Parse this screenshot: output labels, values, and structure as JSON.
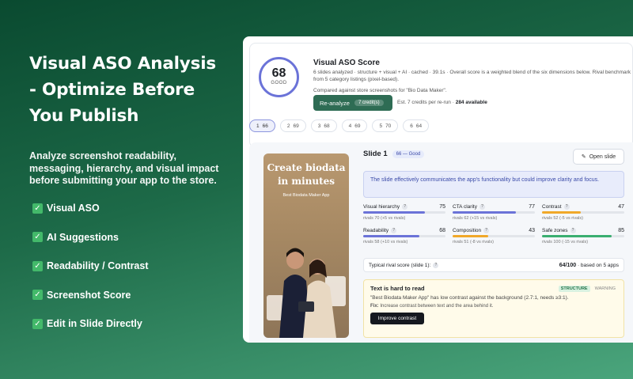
{
  "promo": {
    "headline": "Visual ASO Analysis - Optimize Before You Publish",
    "subheadline": "Analyze screenshot readability, messaging, hierarchy, and visual impact before submitting your app to the store.",
    "features": [
      "Visual ASO",
      "AI Suggestions",
      "Readability / Contrast",
      "Screenshot Score",
      "Edit in Slide Directly"
    ]
  },
  "score": {
    "value": "68",
    "label": "GOOD",
    "title": "Visual ASO Score",
    "description": "6 slides analyzed · structure + visual + AI · cached · 39.1s · Overall score is a weighted blend of the six dimensions below. Rival benchmark from 5 category listings (pixel-based).",
    "compared": "Compared against store screenshots for \"Bio Data Maker\".",
    "reanalyze_label": "Re-analyze",
    "reanalyze_credits": "7 credit(s)",
    "estimate_prefix": "Est. 7 credits per re-run · ",
    "estimate_available": "284 available"
  },
  "tabs": [
    {
      "index": "1",
      "score": "66"
    },
    {
      "index": "2",
      "score": "69"
    },
    {
      "index": "3",
      "score": "68"
    },
    {
      "index": "4",
      "score": "69"
    },
    {
      "index": "5",
      "score": "70"
    },
    {
      "index": "6",
      "score": "64"
    }
  ],
  "slide": {
    "title": "Slide 1",
    "badge": "66 — Good",
    "open_label": "Open slide",
    "image_title": "Create biodata in minutes",
    "image_subtitle": "Best Biodata Maker App",
    "verdict": "The slide effectively communicates the app's functionality but could improve clarity and focus.",
    "metrics": [
      {
        "name": "Visual hierarchy",
        "value": 75,
        "rival": "rivals 70 (+5 vs rivals)",
        "color": "#6b73d8"
      },
      {
        "name": "CTA clarity",
        "value": 77,
        "rival": "rivals 62 (+15 vs rivals)",
        "color": "#6b73d8"
      },
      {
        "name": "Contrast",
        "value": 47,
        "rival": "rivals 52 (-5 vs rivals)",
        "color": "#f0a829"
      },
      {
        "name": "Readability",
        "value": 68,
        "rival": "rivals 58 (+10 vs rivals)",
        "color": "#6b73d8"
      },
      {
        "name": "Composition",
        "value": 43,
        "rival": "rivals 51 (-8 vs rivals)",
        "color": "#f0a829"
      },
      {
        "name": "Safe zones",
        "value": 85,
        "rival": "rivals 100 (-15 vs rivals)",
        "color": "#3aae70"
      }
    ],
    "typical_label": "Typical rival score (slide 1):",
    "typical_value": "64/100",
    "typical_suffix": " · based on 5 apps",
    "warning": {
      "title": "Text is hard to read",
      "tag_structure": "STRUCTURE",
      "tag_level": "WARNING",
      "message": "\"Best Biodata Maker App\" has low contrast against the background (2.7:1, needs ≥3:1).",
      "fix_label": "Fix:",
      "fix_text": " Increase contrast between text and the area behind it.",
      "button": "Improve contrast"
    }
  }
}
